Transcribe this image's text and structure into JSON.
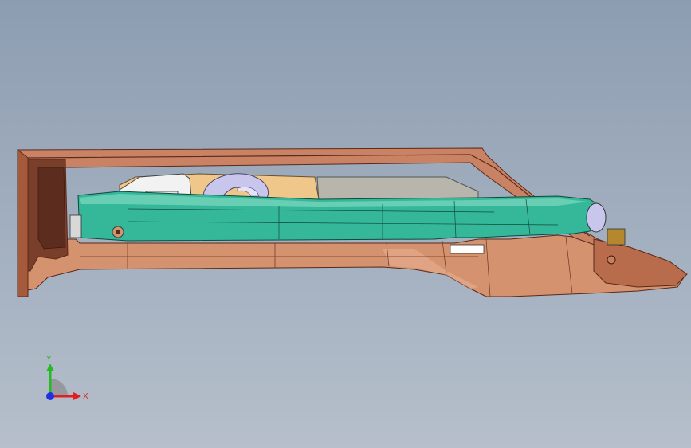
{
  "viewport": {
    "background_top": "#8d9db1",
    "background_bottom": "#b6bfcb"
  },
  "model": {
    "colors": {
      "housing": "#d4926f",
      "housing_dark": "#7a3f2a",
      "housing_edge": "#5a2a1a",
      "body_cyan": "#35b899",
      "body_cyan_light": "#7fd8bf",
      "inner_yellow": "#f0c78a",
      "inner_gray": "#b8b6ac",
      "lavender": "#c9c6ee",
      "white_part": "#f2f2f2"
    }
  },
  "triad": {
    "x_label": "X",
    "y_label": "Y",
    "x_color": "#e02020",
    "y_color": "#22bb22",
    "z_color": "#2030e0"
  }
}
